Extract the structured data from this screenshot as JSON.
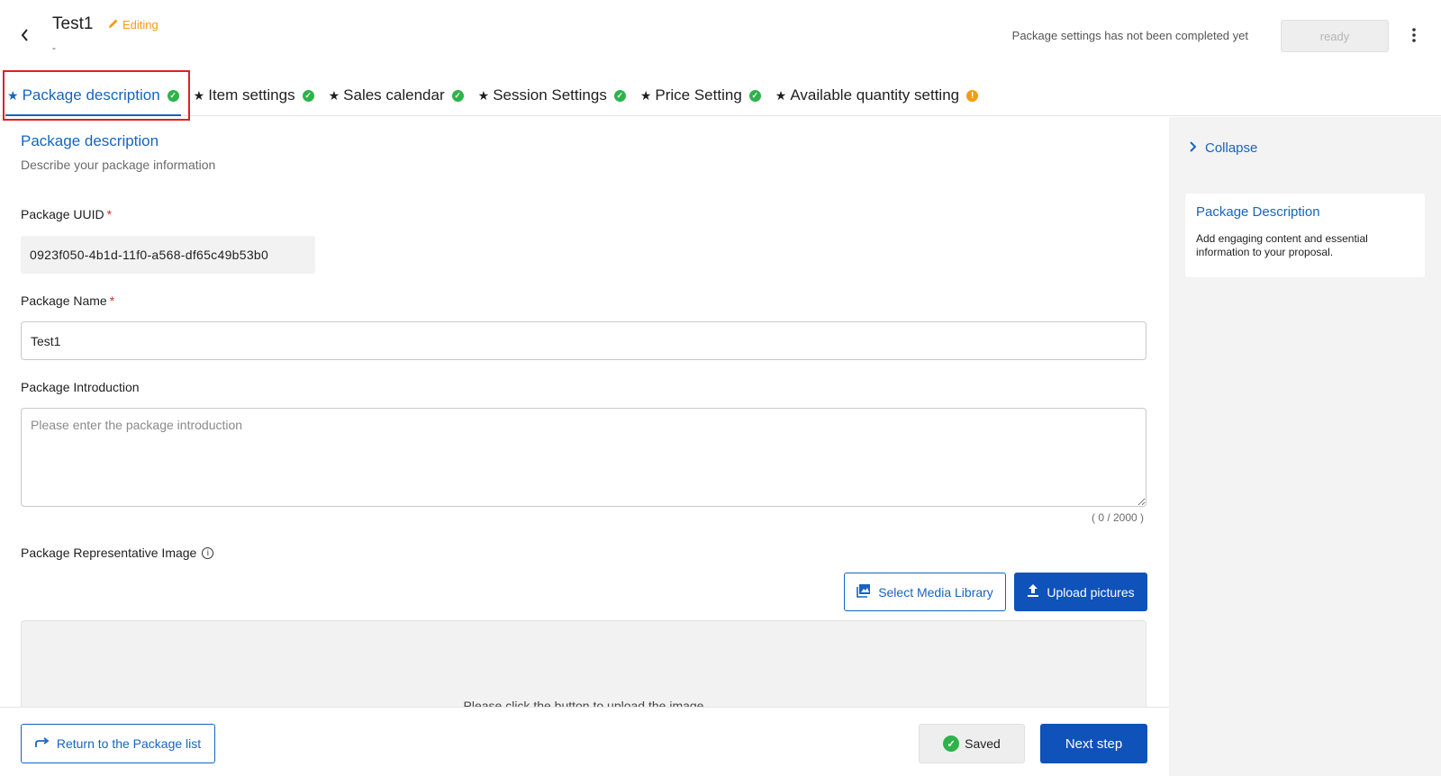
{
  "header": {
    "back_icon": "chevron-left-icon",
    "title": "Test1",
    "editing_label": "Editing",
    "subtitle": "-",
    "status_text": "Package settings has not been completed yet",
    "ready_label": "ready",
    "more_icon": "more-vertical-icon"
  },
  "tabs": [
    {
      "label": "Package description",
      "status": "complete"
    },
    {
      "label": "Item settings",
      "status": "complete"
    },
    {
      "label": "Sales calendar",
      "status": "complete"
    },
    {
      "label": "Session Settings",
      "status": "complete"
    },
    {
      "label": "Price Setting",
      "status": "complete"
    },
    {
      "label": "Available quantity setting",
      "status": "warning"
    }
  ],
  "main": {
    "section_title": "Package description",
    "section_subtitle": "Describe your package information",
    "uuid_label": "Package UUID",
    "uuid_value": "0923f050-4b1d-11f0-a568-df65c49b53b0",
    "name_label": "Package Name",
    "name_value": "Test1",
    "intro_label": "Package Introduction",
    "intro_placeholder": "Please enter the package introduction",
    "intro_counter": "( 0 / 2000 )",
    "image_label": "Package Representative Image",
    "media_button": "Select Media Library",
    "upload_button": "Upload pictures",
    "dropzone_text": "Please click the button to upload the image"
  },
  "side": {
    "collapse_label": "Collapse",
    "card_title": "Package Description",
    "card_body": "Add engaging content and essential information to your proposal."
  },
  "footer": {
    "return_label": "Return to the Package list",
    "saved_label": "Saved",
    "next_label": "Next step"
  },
  "colors": {
    "accent": "#1565c0",
    "primary_button": "#0f52ba",
    "success": "#2db34a",
    "warning": "#f39c12",
    "highlight": "#e02020"
  }
}
